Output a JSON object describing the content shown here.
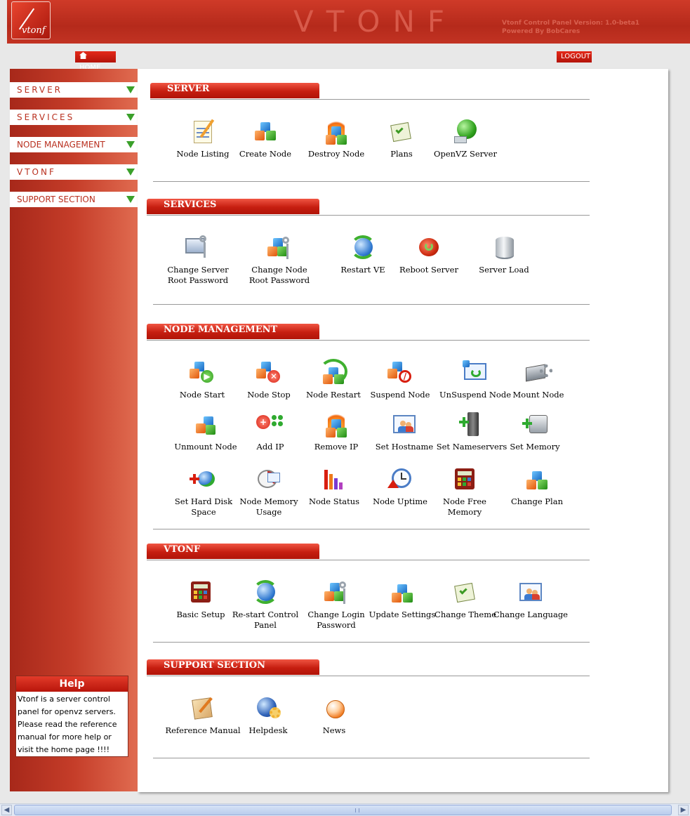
{
  "header": {
    "logo_text": "vtonf",
    "title": "VTONF",
    "version_line": "Vtonf Control Panel Version: 1.0-beta1",
    "powered_by": "Powered By BobCares"
  },
  "nav": {
    "home_label": "HOME",
    "logout_label": "LOGOUT"
  },
  "sidebar": {
    "items": [
      {
        "label": "SERVER"
      },
      {
        "label": "SERVICES"
      },
      {
        "label": "NODE MANAGEMENT"
      },
      {
        "label": "VTONF"
      },
      {
        "label": "SUPPORT SECTION"
      }
    ]
  },
  "help": {
    "title": "Help",
    "body": "Vtonf is a server control panel for openvz servers. Please read the reference manual for more help or visit the home page !!!!"
  },
  "sections": {
    "server": {
      "title": "SERVER",
      "items": [
        {
          "label": "Node Listing",
          "icon": "notepad-icon"
        },
        {
          "label": "Create Node",
          "icon": "cubes-icon"
        },
        {
          "label": "Destroy Node",
          "icon": "cubes-fire-icon"
        },
        {
          "label": "Plans",
          "icon": "checklist-icon"
        },
        {
          "label": "OpenVZ Server",
          "icon": "globe-server-icon"
        }
      ]
    },
    "services": {
      "title": "SERVICES",
      "items": [
        {
          "label": "Change Server Root Password",
          "icon": "monitor-keys-icon"
        },
        {
          "label": "Change Node Root Password",
          "icon": "cubes-keys-icon"
        },
        {
          "label": "Restart VE",
          "icon": "refresh-globe-icon"
        },
        {
          "label": "Reboot Server",
          "icon": "reboot-icon"
        },
        {
          "label": "Server Load",
          "icon": "database-icon"
        }
      ]
    },
    "node_management": {
      "title": "NODE MANAGEMENT",
      "items": [
        {
          "label": "Node Start",
          "icon": "cubes-play-icon"
        },
        {
          "label": "Node Stop",
          "icon": "cubes-stop-icon"
        },
        {
          "label": "Node Restart",
          "icon": "cubes-restart-icon"
        },
        {
          "label": "Suspend Node",
          "icon": "cubes-suspend-icon"
        },
        {
          "label": "UnSuspend Node",
          "icon": "window-unsuspend-icon"
        },
        {
          "label": "Mount Node",
          "icon": "drive-gear-icon"
        },
        {
          "label": "Unmount Node",
          "icon": "cubes-icon"
        },
        {
          "label": "Add IP",
          "icon": "add-ip-icon"
        },
        {
          "label": "Remove IP",
          "icon": "cubes-fire-icon"
        },
        {
          "label": "Set Hostname",
          "icon": "window-users-icon"
        },
        {
          "label": "Set Nameservers",
          "icon": "add-server-icon"
        },
        {
          "label": "Set Memory",
          "icon": "add-drive-icon"
        },
        {
          "label": "Set Hard Disk Space",
          "icon": "add-disk-icon"
        },
        {
          "label": "Node Memory Usage",
          "icon": "memory-usage-icon"
        },
        {
          "label": "Node Status",
          "icon": "bar-chart-icon"
        },
        {
          "label": "Node Uptime",
          "icon": "clock-icon"
        },
        {
          "label": "Node Free Memory",
          "icon": "calculator-icon"
        },
        {
          "label": "Change Plan",
          "icon": "cubes-icon"
        }
      ]
    },
    "vtonf": {
      "title": "VTONF",
      "items": [
        {
          "label": "Basic Setup",
          "icon": "calculator-icon"
        },
        {
          "label": "Re-start Control Panel",
          "icon": "refresh-globe-icon"
        },
        {
          "label": "Change Login Password",
          "icon": "cubes-keys-icon"
        },
        {
          "label": "Update Settings",
          "icon": "cubes-icon"
        },
        {
          "label": "Change Theme",
          "icon": "checklist-icon"
        },
        {
          "label": "Change Language",
          "icon": "window-users-icon"
        }
      ]
    },
    "support": {
      "title": "SUPPORT SECTION",
      "items": [
        {
          "label": "Reference Manual",
          "icon": "book-pen-icon"
        },
        {
          "label": "Helpdesk",
          "icon": "globe-gear-icon"
        },
        {
          "label": "News",
          "icon": "news-icon"
        }
      ]
    }
  },
  "colors": {
    "brand_red": "#c62a1a",
    "sidebar_gradient_start": "#a7281a",
    "sidebar_gradient_end": "#e06b50",
    "arrow_green": "#3aa02a"
  }
}
